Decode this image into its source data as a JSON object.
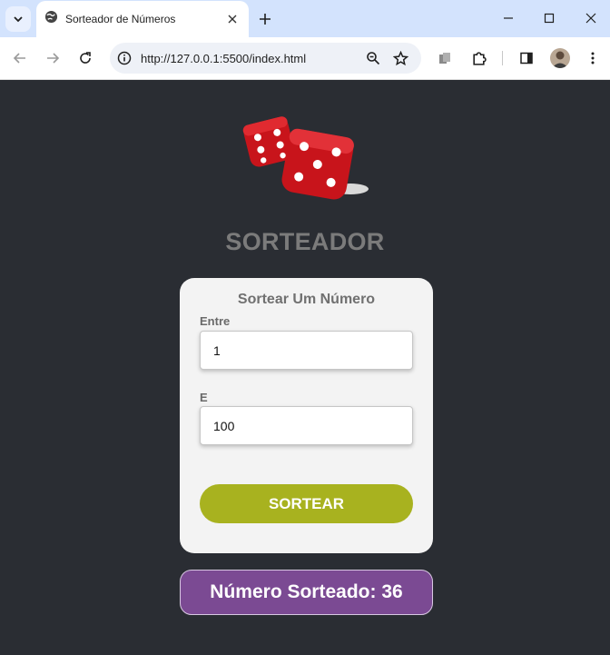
{
  "browser": {
    "tab_title": "Sorteador de Números",
    "url": "http://127.0.0.1:5500/index.html",
    "icons": [
      "tab-search-icon",
      "globe-icon",
      "close-icon",
      "plus-icon",
      "minimize-icon",
      "maximize-icon",
      "window-close-icon",
      "back-icon",
      "forward-icon",
      "reload-icon",
      "site-info-icon",
      "zoom-icon",
      "bookmark-star-icon",
      "extension-tool-icon",
      "puzzle-icon",
      "side-panel-icon",
      "avatar",
      "more-icon"
    ]
  },
  "page": {
    "heading": "SORTEADOR",
    "card": {
      "title": "Sortear Um Número",
      "from_label": "Entre",
      "from_value": "1",
      "to_label": "E",
      "to_value": "100",
      "button_label": "SORTEAR"
    },
    "result": "Número Sorteado: 36"
  },
  "colors": {
    "background": "#2a2d33",
    "card": "#f3f3f3",
    "button": "#a8b21f",
    "result": "#7b4a93",
    "dice": "#c8141b"
  }
}
